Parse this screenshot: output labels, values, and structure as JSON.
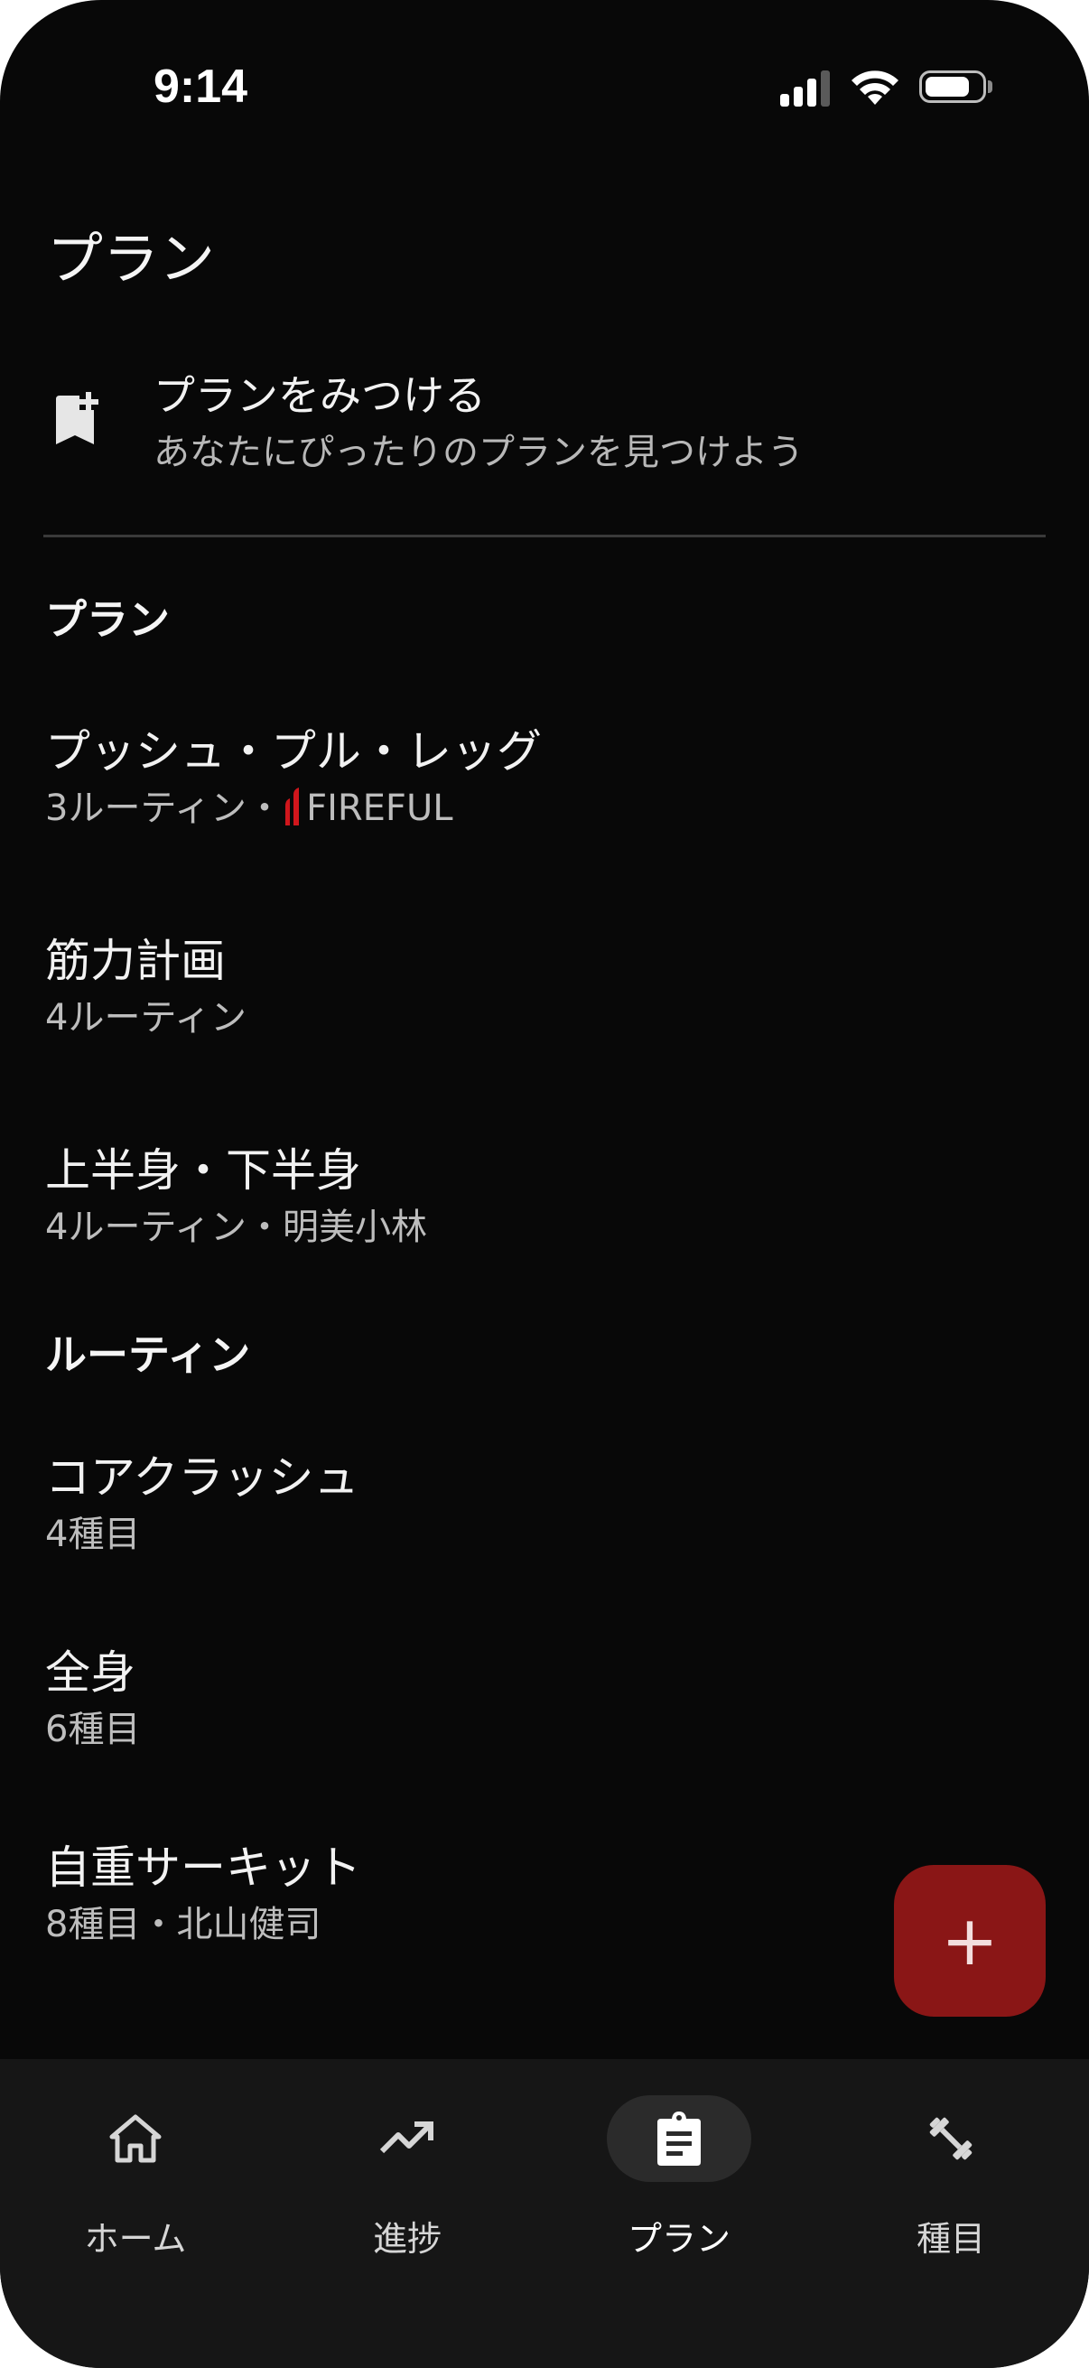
{
  "status_bar": {
    "time": "9:14"
  },
  "page_title": "プラン",
  "discover": {
    "title": "プランをみつける",
    "subtitle": "あなたにぴったりのプランを見つけよう"
  },
  "plans_section": {
    "header": "プラン",
    "items": [
      {
        "title": "プッシュ・プル・レッグ",
        "meta": "3ルーティン・",
        "brand": "FIREFUL"
      },
      {
        "title": "筋力計画",
        "meta": "4ルーティン"
      },
      {
        "title": "上半身・下半身",
        "meta": "4ルーティン・明美小林"
      }
    ]
  },
  "routines_section": {
    "header": "ルーティン",
    "items": [
      {
        "title": "コアクラッシュ",
        "meta": "4種目"
      },
      {
        "title": "全身",
        "meta": "6種目"
      },
      {
        "title": "自重サーキット",
        "meta": "8種目・北山健司"
      }
    ]
  },
  "fab": {
    "label": "+"
  },
  "bottom_nav": {
    "items": [
      {
        "label": "ホーム",
        "icon": "home-icon"
      },
      {
        "label": "進捗",
        "icon": "trending-up-icon"
      },
      {
        "label": "プラン",
        "icon": "clipboard-icon",
        "active": true
      },
      {
        "label": "種目",
        "icon": "dumbbell-icon"
      }
    ]
  },
  "colors": {
    "background": "#080808",
    "fab": "#8a1616",
    "brand_red": "#d0161c",
    "nav_background": "#161616"
  }
}
